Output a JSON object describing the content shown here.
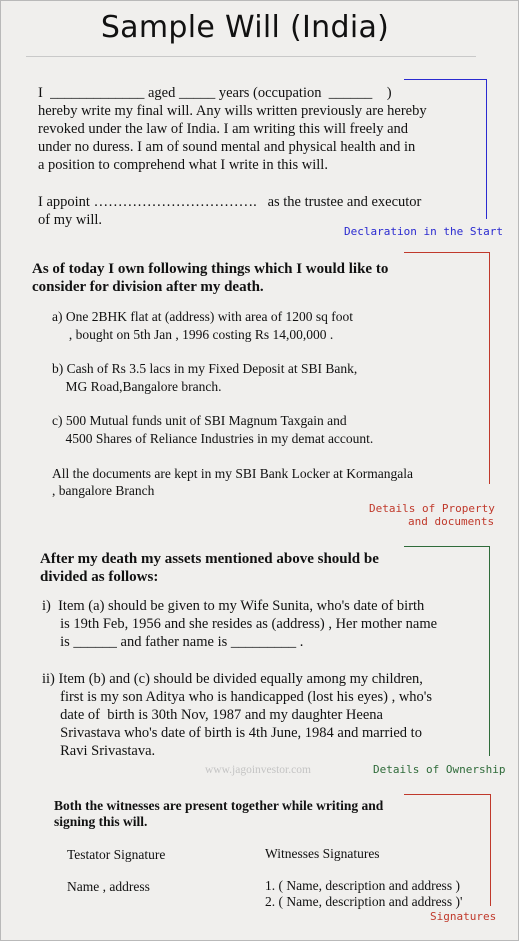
{
  "title": "Sample Will (India)",
  "declaration": {
    "lines": [
      "I  _____________ aged _____ years (occupation  ______    )",
      "hereby write my final will. Any wills written previously are hereby",
      "revoked under the law of India. I am writing this will freely and",
      "under no duress. I am of sound mental and physical health and in",
      "a position to comprehend what I write in this will."
    ],
    "appoint_lines": [
      "I appoint …………………………….   as the trustee and executor",
      "of my will."
    ],
    "annotation": "Declaration in the Start",
    "annotation_color": "#2a2ad0"
  },
  "property": {
    "heading_lines": [
      "As of today I own following things which I would like to",
      "consider for division after my death."
    ],
    "items": [
      [
        "a) One 2BHK flat at (address) with area of 1200 sq foot",
        "     , bought on 5th Jan , 1996 costing Rs 14,00,000 ."
      ],
      [
        "b) Cash of Rs 3.5 lacs in my Fixed Deposit at SBI Bank,",
        "    MG Road,Bangalore branch."
      ],
      [
        "c) 500 Mutual funds unit of SBI Magnum Taxgain and",
        "    4500 Shares of Reliance Industries in my demat account."
      ],
      [
        "All the documents are kept in my SBI Bank Locker at Kormangala",
        ", bangalore Branch"
      ]
    ],
    "annotation_lines": [
      "Details of Property",
      "and documents"
    ],
    "annotation_color": "#c0392b"
  },
  "division": {
    "heading_lines": [
      "After my death my assets mentioned above should be",
      "divided as follows:"
    ],
    "item_i": [
      "i)  Item (a) should be given to my Wife Sunita, who's date of birth",
      "     is 19th Feb, 1956 and she resides as (address) , Her mother name",
      "     is ______ and father name is _________ ."
    ],
    "item_ii": [
      "ii) Item (b) and (c) should be divided equally among my children,",
      "     first is my son Aditya who is handicapped (lost his eyes) , who's",
      "     date of  birth is 30th Nov, 1987 and my daughter Heena",
      "     Srivastava who's date of birth is 4th June, 1984 and married to",
      "     Ravi Srivastava."
    ],
    "watermark": "www.jagoinvestor.com",
    "annotation": "Details of Ownership",
    "annotation_color": "#2f6b3a"
  },
  "witnesses": {
    "heading_lines": [
      "Both the witnesses are present together while writing and",
      "signing this will."
    ],
    "testator_signature": "Testator Signature",
    "witnesses_signatures": "Witnesses Signatures",
    "name_address": "Name , address",
    "witness_1": "1. ( Name, description and address )",
    "witness_2": "2. ( Name, description and address )'",
    "annotation": "Signatures",
    "annotation_color": "#c0392b"
  }
}
